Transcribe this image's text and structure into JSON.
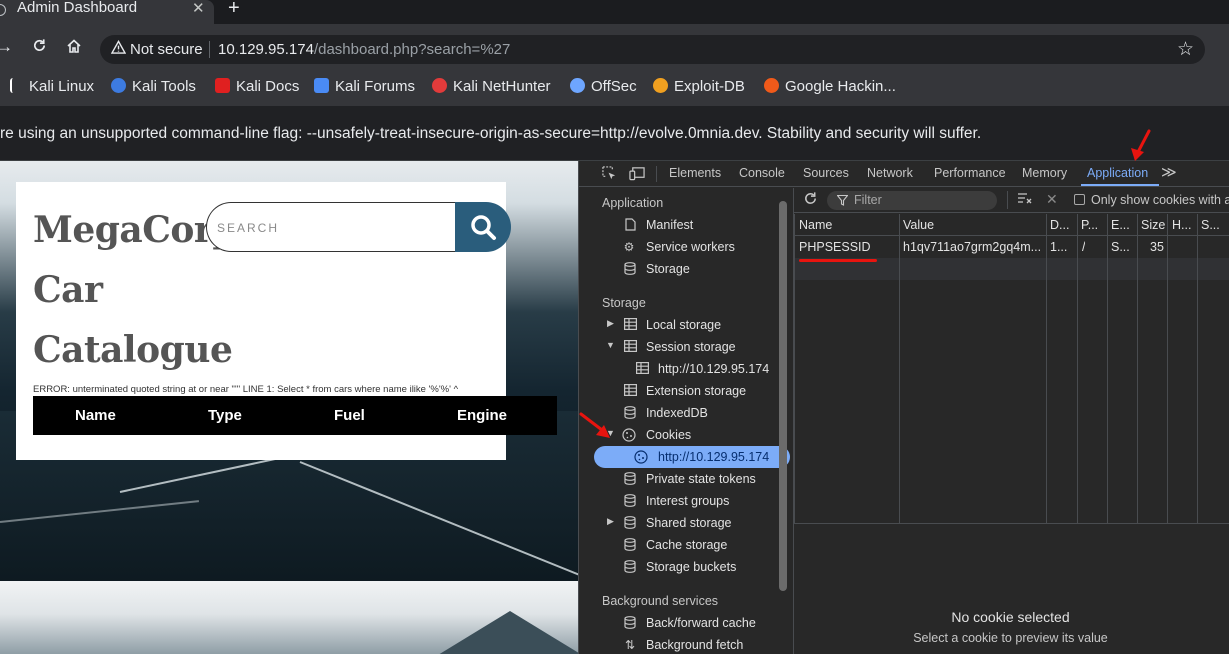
{
  "browser": {
    "tab_title": "Admin Dashboard",
    "close_glyph": "✕",
    "newtab_glyph": "+",
    "security_label": "Not secure",
    "url_host": "10.129.95.174",
    "url_path": "/dashboard.php?search=%27"
  },
  "bookmarks": [
    {
      "label": "Kali Linux",
      "icon": "kali-dragon-icon",
      "color": "#ffffff"
    },
    {
      "label": "Kali Tools",
      "icon": "kali-tools-icon",
      "color": "#3d7be0"
    },
    {
      "label": "Kali Docs",
      "icon": "kali-docs-icon",
      "color": "#e02020"
    },
    {
      "label": "Kali Forums",
      "icon": "kali-forums-icon",
      "color": "#4a8bf5"
    },
    {
      "label": "Kali NetHunter",
      "icon": "nethunter-icon",
      "color": "#e23b3b"
    },
    {
      "label": "OffSec",
      "icon": "offsec-icon",
      "color": "#6ea6ff"
    },
    {
      "label": "Exploit-DB",
      "icon": "exploitdb-icon",
      "color": "#f0a020"
    },
    {
      "label": "Google Hackin...",
      "icon": "ghdb-icon",
      "color": "#f05a1a"
    }
  ],
  "infobar": {
    "message": "re using an unsupported command-line flag: --unsafely-treat-insecure-origin-as-secure=http://evolve.0mnia.dev. Stability and security will suffer."
  },
  "site": {
    "brand_line1": "MegaCorp",
    "brand_line2": "Car",
    "brand_line3": "Catalogue",
    "search_placeholder": "SEARCH",
    "error": "ERROR: unterminated quoted string at or near \"'\" LINE 1: Select * from cars where name ilike '%'%' ^",
    "columns": [
      "Name",
      "Type",
      "Fuel",
      "Engine"
    ]
  },
  "devtools": {
    "tabs": [
      "Elements",
      "Console",
      "Sources",
      "Network",
      "Performance",
      "Memory",
      "Application"
    ],
    "active_tab": "Application",
    "more_glyph": "≫",
    "sidebar": {
      "application_header": "Application",
      "application_items": [
        "Manifest",
        "Service workers",
        "Storage"
      ],
      "storage_header": "Storage",
      "storage_items": [
        "Local storage",
        "Session storage",
        "http://10.129.95.174",
        "Extension storage",
        "IndexedDB",
        "Cookies",
        "http://10.129.95.174",
        "Private state tokens",
        "Interest groups",
        "Shared storage",
        "Cache storage",
        "Storage buckets"
      ],
      "background_header": "Background services",
      "background_items": [
        "Back/forward cache",
        "Background fetch"
      ]
    },
    "cookies": {
      "filter_placeholder": "Filter",
      "only_show_label": "Only show cookies with an",
      "headers": [
        "Name",
        "Value",
        "D...",
        "P...",
        "E...",
        "Size",
        "H...",
        "S..."
      ],
      "row": {
        "name": "PHPSESSID",
        "value": "h1qv711ao7grm2gq4m...",
        "domain": "1...",
        "path": "/",
        "expires": "S...",
        "size": "35"
      },
      "preview_title": "No cookie selected",
      "preview_subtitle": "Select a cookie to preview its value"
    }
  },
  "colors": {
    "accent": "#7cacf8",
    "annotation": "#e8140f",
    "search_button": "#2a5d7c"
  }
}
